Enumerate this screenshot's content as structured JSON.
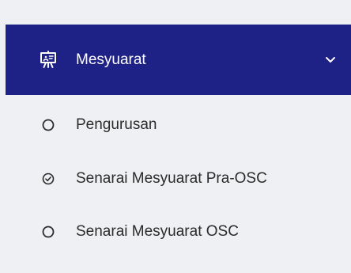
{
  "colors": {
    "background": "#eef0f3",
    "header_background": "#1e2185",
    "header_text": "#ffffff",
    "item_text": "#2b2b2b"
  },
  "menu": {
    "icon": "presentation-board-icon",
    "label": "Mesyuarat",
    "chevron_icon": "chevron-down-icon",
    "items": [
      {
        "label": "Pengurusan",
        "icon": "circle-outline-icon",
        "state": "unchecked"
      },
      {
        "label": "Senarai Mesyuarat Pra-OSC",
        "icon": "circle-check-icon",
        "state": "checked"
      },
      {
        "label": "Senarai Mesyuarat OSC",
        "icon": "circle-outline-icon",
        "state": "unchecked"
      }
    ]
  }
}
